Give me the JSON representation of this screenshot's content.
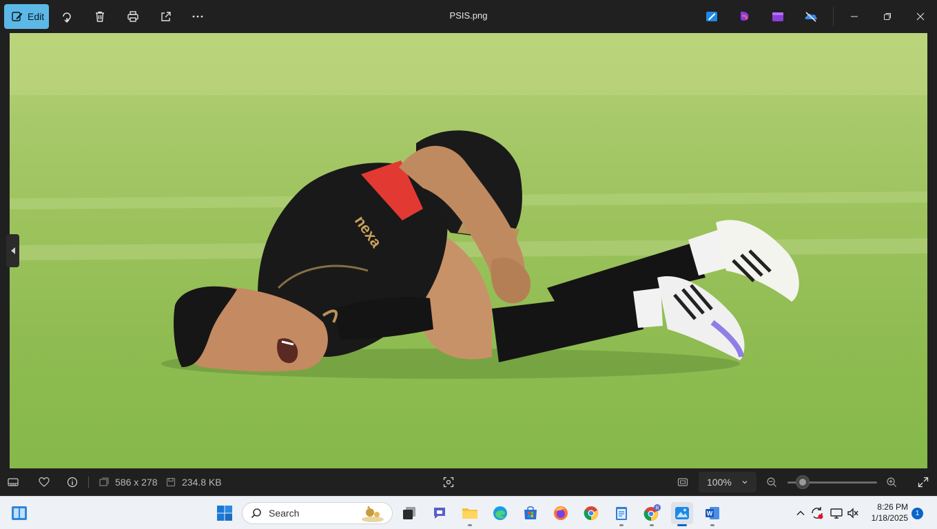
{
  "toolbar": {
    "edit_label": "Edit",
    "file_title": "PSIS.png",
    "icons": [
      "edit-icon",
      "rotate-icon",
      "delete-icon",
      "print-icon",
      "share-icon",
      "more-icon"
    ]
  },
  "app_shortcuts": [
    "designer-icon",
    "clipchamp-icon",
    "video-editor-icon",
    "onedrive-icon"
  ],
  "statusbar": {
    "dimensions": "586 x 278",
    "file_size": "234.8 KB",
    "zoom": "100%"
  },
  "taskbar": {
    "search_placeholder": "Search",
    "time": "8:26 PM",
    "date": "1/18/2025",
    "notification_count": "1"
  },
  "photo": {
    "jersey_text": "nexa"
  },
  "colors": {
    "accent": "#5cb8e6",
    "grass": "#9cc25c",
    "taskbar": "#eef1f5"
  }
}
